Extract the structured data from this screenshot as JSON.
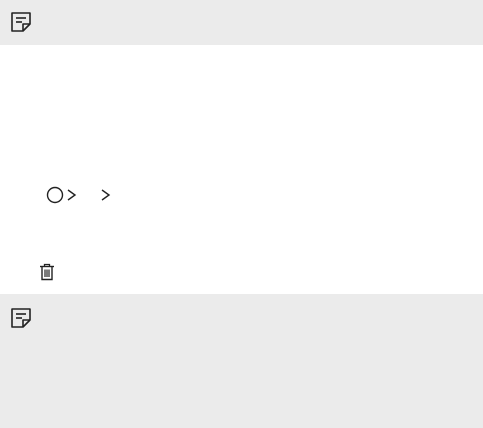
{
  "icons": {
    "note_top": "note-icon",
    "note_bottom": "note-icon",
    "home": "circle-home-icon",
    "chevron_1": "chevron-right-icon",
    "chevron_2": "chevron-right-icon",
    "delete": "trash-icon"
  },
  "colors": {
    "note_background": "#ebebeb",
    "icon_stroke": "#222222",
    "page_background": "#ffffff"
  }
}
